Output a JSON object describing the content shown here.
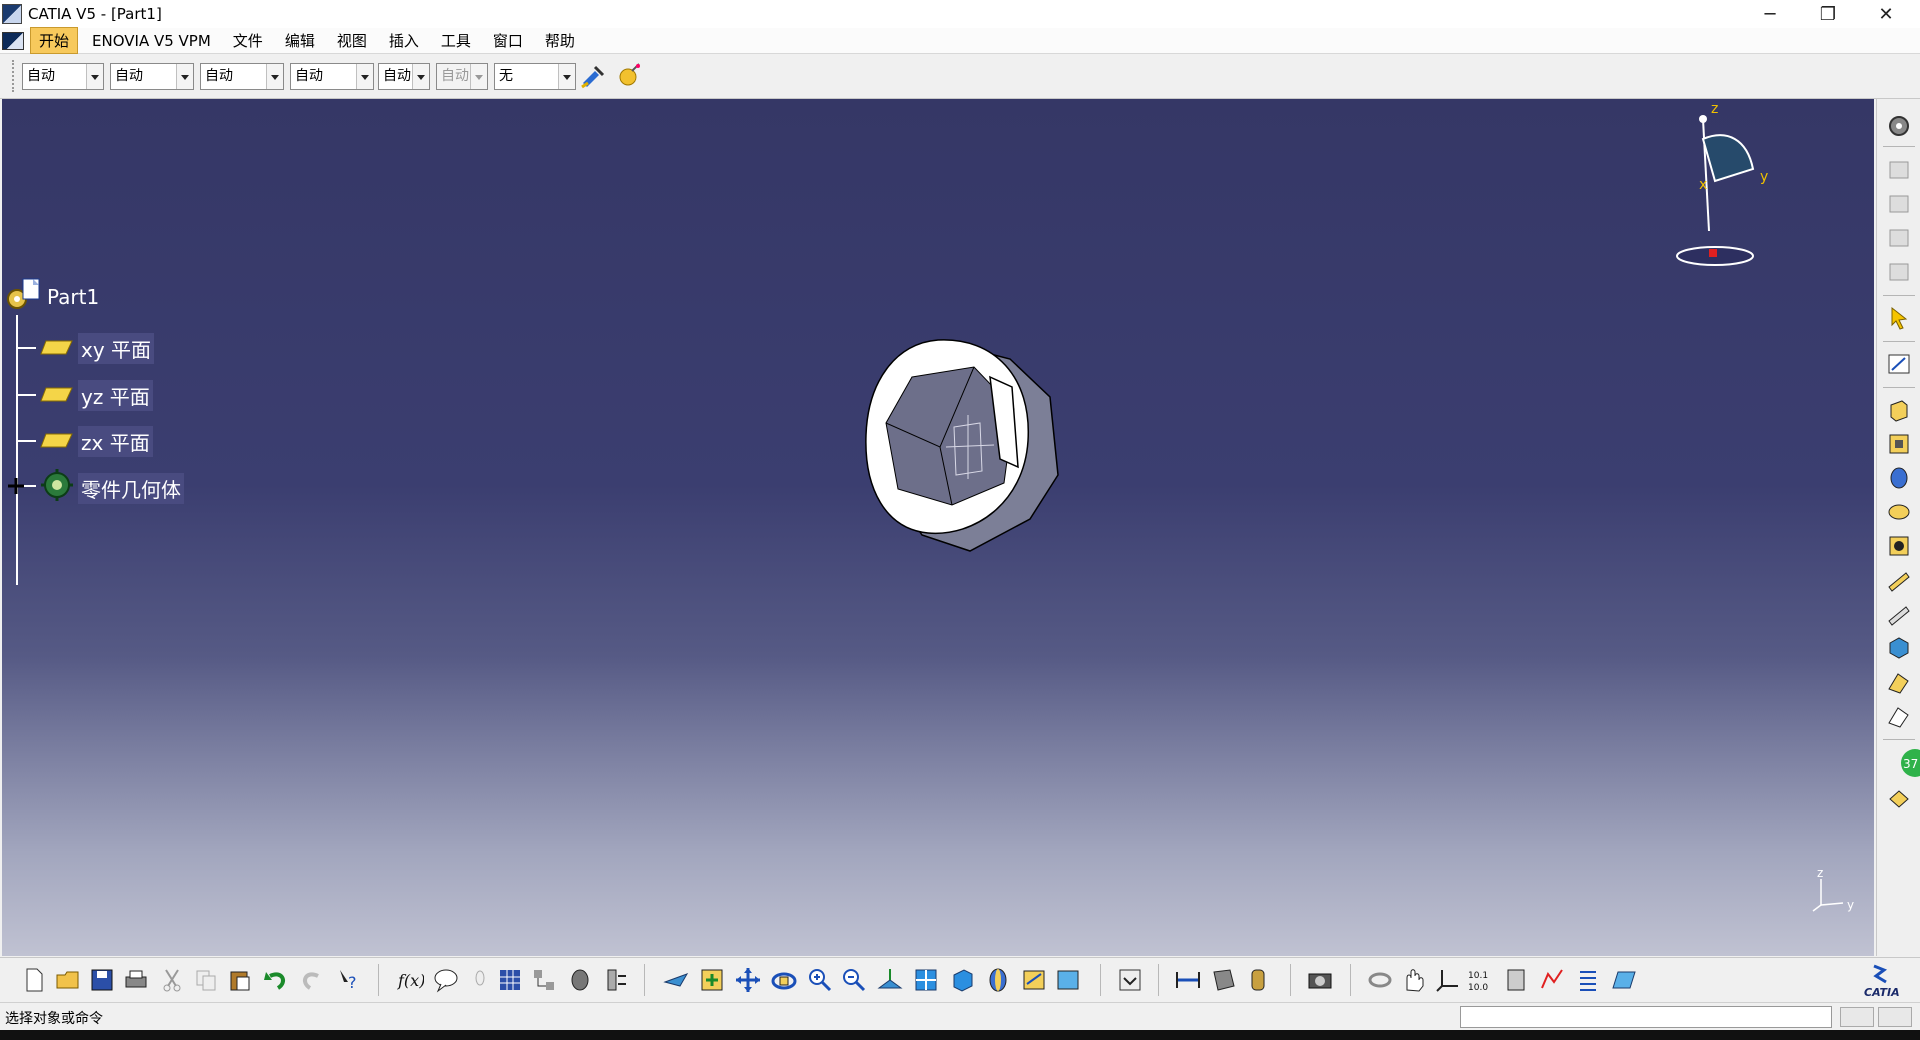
{
  "window": {
    "title": "CATIA V5 - [Part1]",
    "minimize_glyph": "─",
    "restore_glyph": "❐",
    "close_glyph": "✕"
  },
  "mdi_controls": {
    "minimize": "_",
    "restore": "❐",
    "close": "✕"
  },
  "menu": [
    {
      "label": "开始",
      "active": true
    },
    {
      "label": "ENOVIA V5 VPM"
    },
    {
      "label": "文件"
    },
    {
      "label": "编辑"
    },
    {
      "label": "视图"
    },
    {
      "label": "插入"
    },
    {
      "label": "工具"
    },
    {
      "label": "窗口"
    },
    {
      "label": "帮助"
    }
  ],
  "graphic_properties": {
    "combos": [
      "自动",
      "自动",
      "自动",
      "自动",
      "自动",
      "自动",
      "无"
    ],
    "combo_disabled_index": 5
  },
  "tree": {
    "root": "Part1",
    "children": [
      "xy 平面",
      "yz 平面",
      "zx 平面",
      "零件几何体"
    ]
  },
  "compass": {
    "x": "x",
    "y": "y",
    "z": "z"
  },
  "axis_triad": {
    "z": "z",
    "y": "y"
  },
  "status": {
    "message": "选择对象或命令",
    "command_placeholder": ""
  },
  "badges": {
    "right_toolbar_counter": "37"
  },
  "brand": {
    "logo_text": "CATIA"
  },
  "colors": {
    "viewport_top": "#353766",
    "viewport_bottom": "#c0c2d2",
    "menu_highlight": "#f7c95c",
    "tree_highlight": "#494b80"
  }
}
